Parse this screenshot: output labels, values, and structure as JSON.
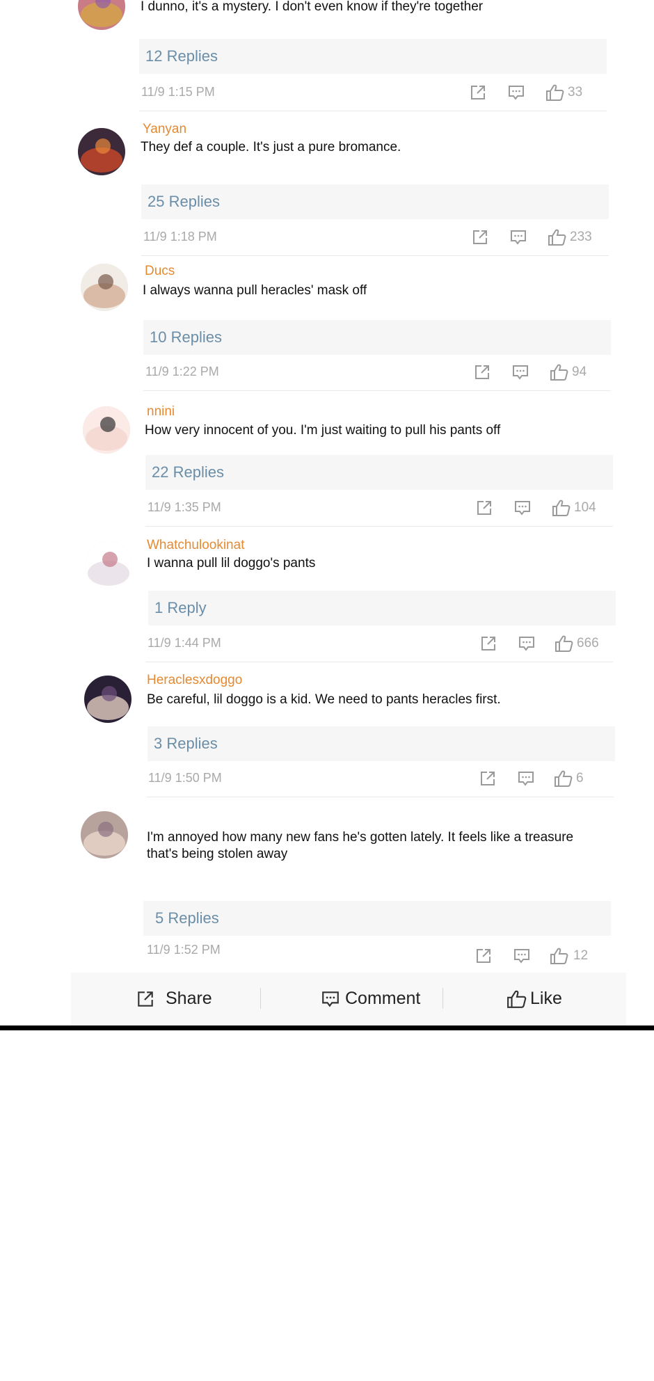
{
  "comments": [
    {
      "username": "",
      "text": "I dunno, it's a mystery. I don't even know if they're together",
      "replies": "12 Replies",
      "time": "11/9 1:15 PM",
      "likes": "33",
      "avatar_colors": [
        "#c97b86",
        "#d4a24a",
        "#8e5fa8"
      ]
    },
    {
      "username": "Yanyan",
      "text": "They def a couple. It's just a pure bromance.",
      "replies": "25 Replies",
      "time": "11/9 1:18 PM",
      "likes": "233",
      "avatar_colors": [
        "#3c2a3a",
        "#c2452a",
        "#e9893a"
      ]
    },
    {
      "username": "Ducs",
      "text": "I always wanna pull heracles' mask off",
      "replies": "10 Replies",
      "time": "11/9 1:22 PM",
      "likes": "94",
      "avatar_colors": [
        "#f2ece6",
        "#d6b39c",
        "#7a5a4a"
      ]
    },
    {
      "username": "nnini",
      "text": "How very innocent of you. I'm just waiting to pull his pants off",
      "replies": "22 Replies",
      "time": "11/9 1:35 PM",
      "likes": "104",
      "avatar_colors": [
        "#fbeae6",
        "#f3d6cf",
        "#333333"
      ]
    },
    {
      "username": "Whatchulookinat",
      "text": "I wanna pull lil doggo's pants",
      "replies": "1 Reply",
      "time": "11/9 1:44 PM",
      "likes": "666",
      "avatar_colors": [
        "#ffffff",
        "#e8e0e8",
        "#c47a8a"
      ]
    },
    {
      "username": "Heraclesxdoggo",
      "text": "Be careful, lil doggo is a kid. We need to pants heracles first.",
      "replies": "3 Replies",
      "time": "11/9 1:50 PM",
      "likes": "6",
      "avatar_colors": [
        "#2a2036",
        "#d7c3b9",
        "#6d4f7a"
      ]
    },
    {
      "username": "",
      "text": "I'm annoyed how many new fans he's gotten lately. It feels like a treasure that's being stolen away",
      "replies": "5 Replies",
      "time": "11/9 1:52 PM",
      "likes": "12",
      "avatar_colors": [
        "#b8a39c",
        "#e7d3c8",
        "#8c6f80"
      ]
    }
  ],
  "bottom_bar": {
    "share_label": "Share",
    "comment_label": "Comment",
    "like_label": "Like"
  },
  "colors": {
    "username": "#e58a32",
    "replies_link": "#6a8da8",
    "meta_text": "#a9a9a9",
    "icon_gray": "#9a9a9a"
  },
  "icons": {
    "share": "share-icon",
    "comment": "comment-icon",
    "like": "thumbs-up-icon"
  }
}
